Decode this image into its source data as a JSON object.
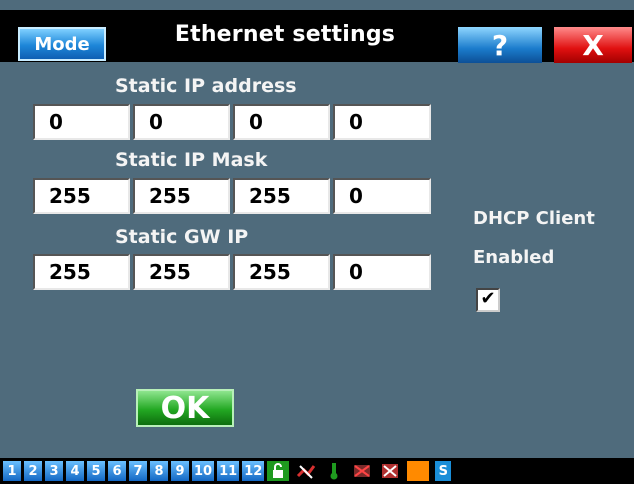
{
  "window": {
    "title": "Ethernet settings",
    "mode_label": "Mode",
    "help_label": "?",
    "close_label": "X"
  },
  "static_ip": {
    "label": "Static IP address",
    "octets": [
      "0",
      "0",
      "0",
      "0"
    ]
  },
  "static_mask": {
    "label": "Static IP Mask",
    "octets": [
      "255",
      "255",
      "255",
      "0"
    ]
  },
  "static_gw": {
    "label": "Static GW IP",
    "octets": [
      "255",
      "255",
      "255",
      "0"
    ]
  },
  "dhcp": {
    "label_line1": "DHCP Client",
    "label_line2": "Enabled",
    "checked": true,
    "check_glyph": "✔"
  },
  "ok_label": "OK",
  "taskbar": {
    "numbers": [
      "1",
      "2",
      "3",
      "4",
      "5",
      "6",
      "7",
      "8",
      "9",
      "10",
      "11",
      "12"
    ],
    "icons": [
      {
        "name": "lock-icon",
        "glyph": "🔓",
        "color": "#1f9a1f"
      },
      {
        "name": "network-disconnected-icon",
        "glyph": "⚡",
        "color": "#d83030"
      },
      {
        "name": "thermometer-icon",
        "glyph": "🌡",
        "color": "#1f9a1f"
      },
      {
        "name": "fan-off-icon",
        "glyph": "✕",
        "color": "#c44"
      },
      {
        "name": "pump-off-icon",
        "glyph": "✕",
        "color": "#c44"
      },
      {
        "name": "orange-status-icon",
        "glyph": "",
        "color": "#ff8a00"
      },
      {
        "name": "settings-s-icon",
        "glyph": "S",
        "color": "#1a8ed8"
      }
    ]
  },
  "colors": {
    "panel_bg": "#4f6b7c",
    "title_bg": "#000000",
    "ok_green": "#23a823",
    "close_red": "#e01010",
    "mode_blue": "#1d86d8"
  }
}
